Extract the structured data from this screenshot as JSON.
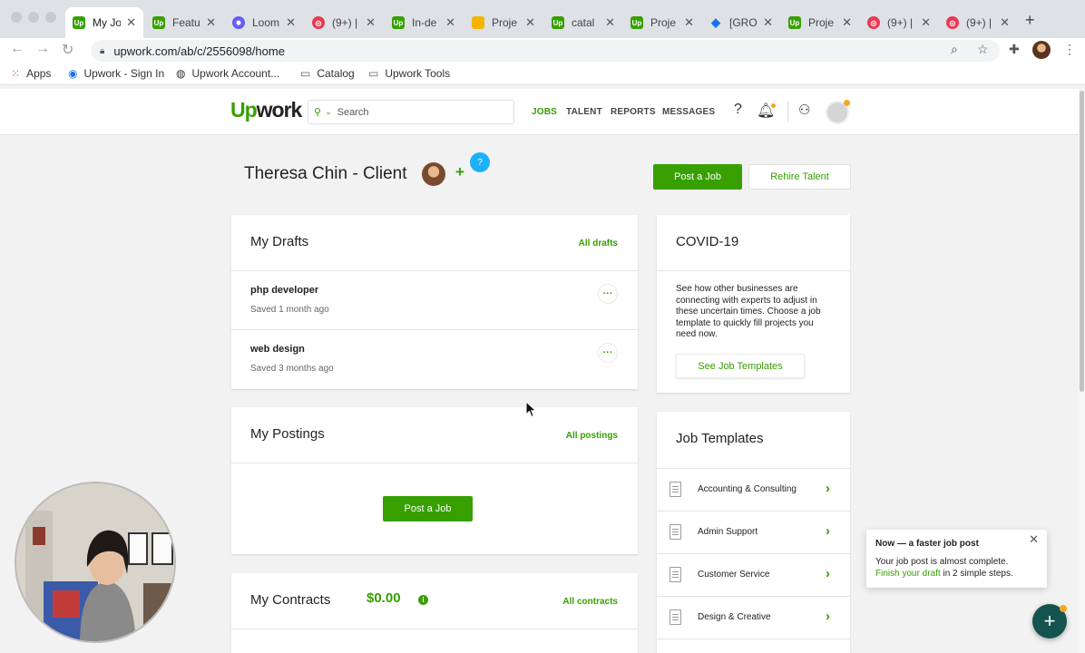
{
  "browser": {
    "tabs": [
      {
        "title": "My Jo",
        "color": "#37a000",
        "active": true
      },
      {
        "title": "Featu",
        "color": "#37a000"
      },
      {
        "title": "Loom",
        "color": "#625df5"
      },
      {
        "title": "(9+) |",
        "color": "#e8384f"
      },
      {
        "title": "In-de",
        "color": "#37a000"
      },
      {
        "title": "Proje",
        "color": "#f4b400"
      },
      {
        "title": "catal",
        "color": "#37a000"
      },
      {
        "title": "Proje",
        "color": "#37a000"
      },
      {
        "title": "[GRO",
        "color": "#1a73e8"
      },
      {
        "title": "Proje",
        "color": "#37a000"
      },
      {
        "title": "(9+) |",
        "color": "#e8384f"
      },
      {
        "title": "(9+) |",
        "color": "#e8384f"
      }
    ],
    "url": "upwork.com/ab/c/2556098/home",
    "bookmarks": {
      "apps": "Apps",
      "signin": "Upwork - Sign In",
      "account": "Upwork Account...",
      "catalog": "Catalog",
      "tools": "Upwork Tools"
    }
  },
  "header": {
    "logo_up": "Up",
    "logo_work": "work",
    "search_placeholder": "Search",
    "nav": {
      "jobs": "JOBS",
      "talent": "TALENT",
      "reports": "REPORTS",
      "messages": "MESSAGES"
    }
  },
  "client": {
    "name": "Theresa Chin - Client",
    "post_job": "Post a Job",
    "rehire": "Rehire Talent"
  },
  "drafts": {
    "title": "My Drafts",
    "link": "All drafts",
    "items": [
      {
        "name": "php developer",
        "saved": "Saved 1 month ago"
      },
      {
        "name": "web design",
        "saved": "Saved 3 months ago"
      }
    ]
  },
  "covid": {
    "title": "COVID-19",
    "text": "See how other businesses are connecting with experts to adjust in these uncertain times. Choose a job template to quickly fill projects you need now.",
    "button": "See Job Templates"
  },
  "postings": {
    "title": "My Postings",
    "link": "All postings",
    "button": "Post a Job"
  },
  "templates": {
    "title": "Job Templates",
    "items": [
      "Accounting & Consulting",
      "Admin Support",
      "Customer Service",
      "Design & Creative"
    ]
  },
  "contracts": {
    "title": "My Contracts",
    "amount": "$0.00",
    "link": "All contracts"
  },
  "toast": {
    "title": "Now — a faster job post",
    "line1": "Your job post is almost complete.",
    "link": "Finish your draft",
    "line2": " in 2 simple steps."
  },
  "colors": {
    "brand": "#37a000",
    "fab": "#13544e",
    "help": "#1cb0f6"
  }
}
